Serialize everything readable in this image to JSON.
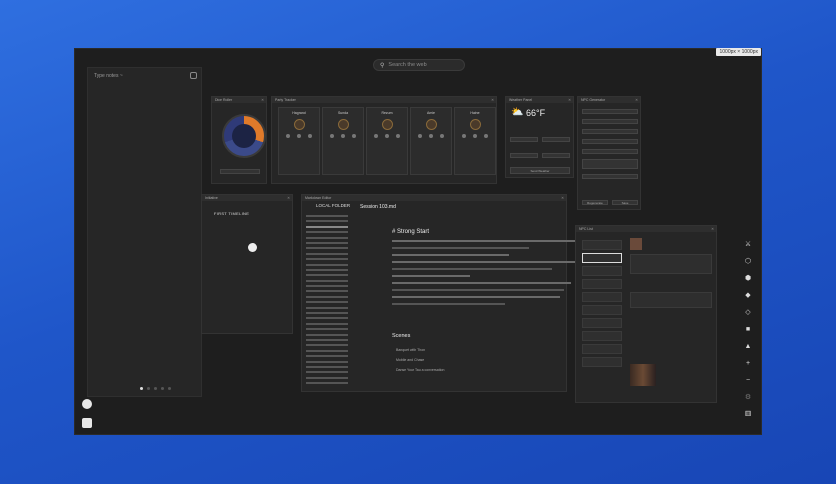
{
  "app": {
    "size_badge": "1000px × 1000px",
    "search_placeholder": "Search the web"
  },
  "left_panel": {
    "title": "Type notes ~"
  },
  "widgets": {
    "dice_roller": {
      "title": "Dice Roller"
    },
    "party_tracker": {
      "title": "Party Tracker",
      "members": [
        {
          "name": "Hagrand"
        },
        {
          "name": "Sunda"
        },
        {
          "name": "Rezum"
        },
        {
          "name": "Amie"
        },
        {
          "name": "Haine"
        }
      ]
    },
    "weather": {
      "title": "Weather Panel",
      "temp": "66°F",
      "button": "Send Weather"
    },
    "npc_generator": {
      "title": "NPC Generator",
      "btn_left": "Regenerate",
      "btn_right": "Save"
    },
    "initiative": {
      "title": "Initiative",
      "heading": "FIRST TIMELINE"
    },
    "files": {
      "title": "Markdown Editor",
      "folder": "LOCAL FOLDER",
      "filename": "Session 103.md",
      "heading": "# Strong Start",
      "scenes_heading": "Scenes",
      "scenes": [
        "Banquet with Thon",
        "Mobile and Chase",
        "Danse Your Tau a conversation"
      ]
    },
    "npc_list": {
      "title": "NPC List"
    }
  },
  "dock_icons": [
    "swords-icon",
    "d20-icon",
    "d12-icon",
    "d10-icon",
    "d8-icon",
    "d6-icon",
    "d4-icon",
    "plus-icon",
    "minus-icon",
    "settings-icon",
    "dice-icon"
  ]
}
